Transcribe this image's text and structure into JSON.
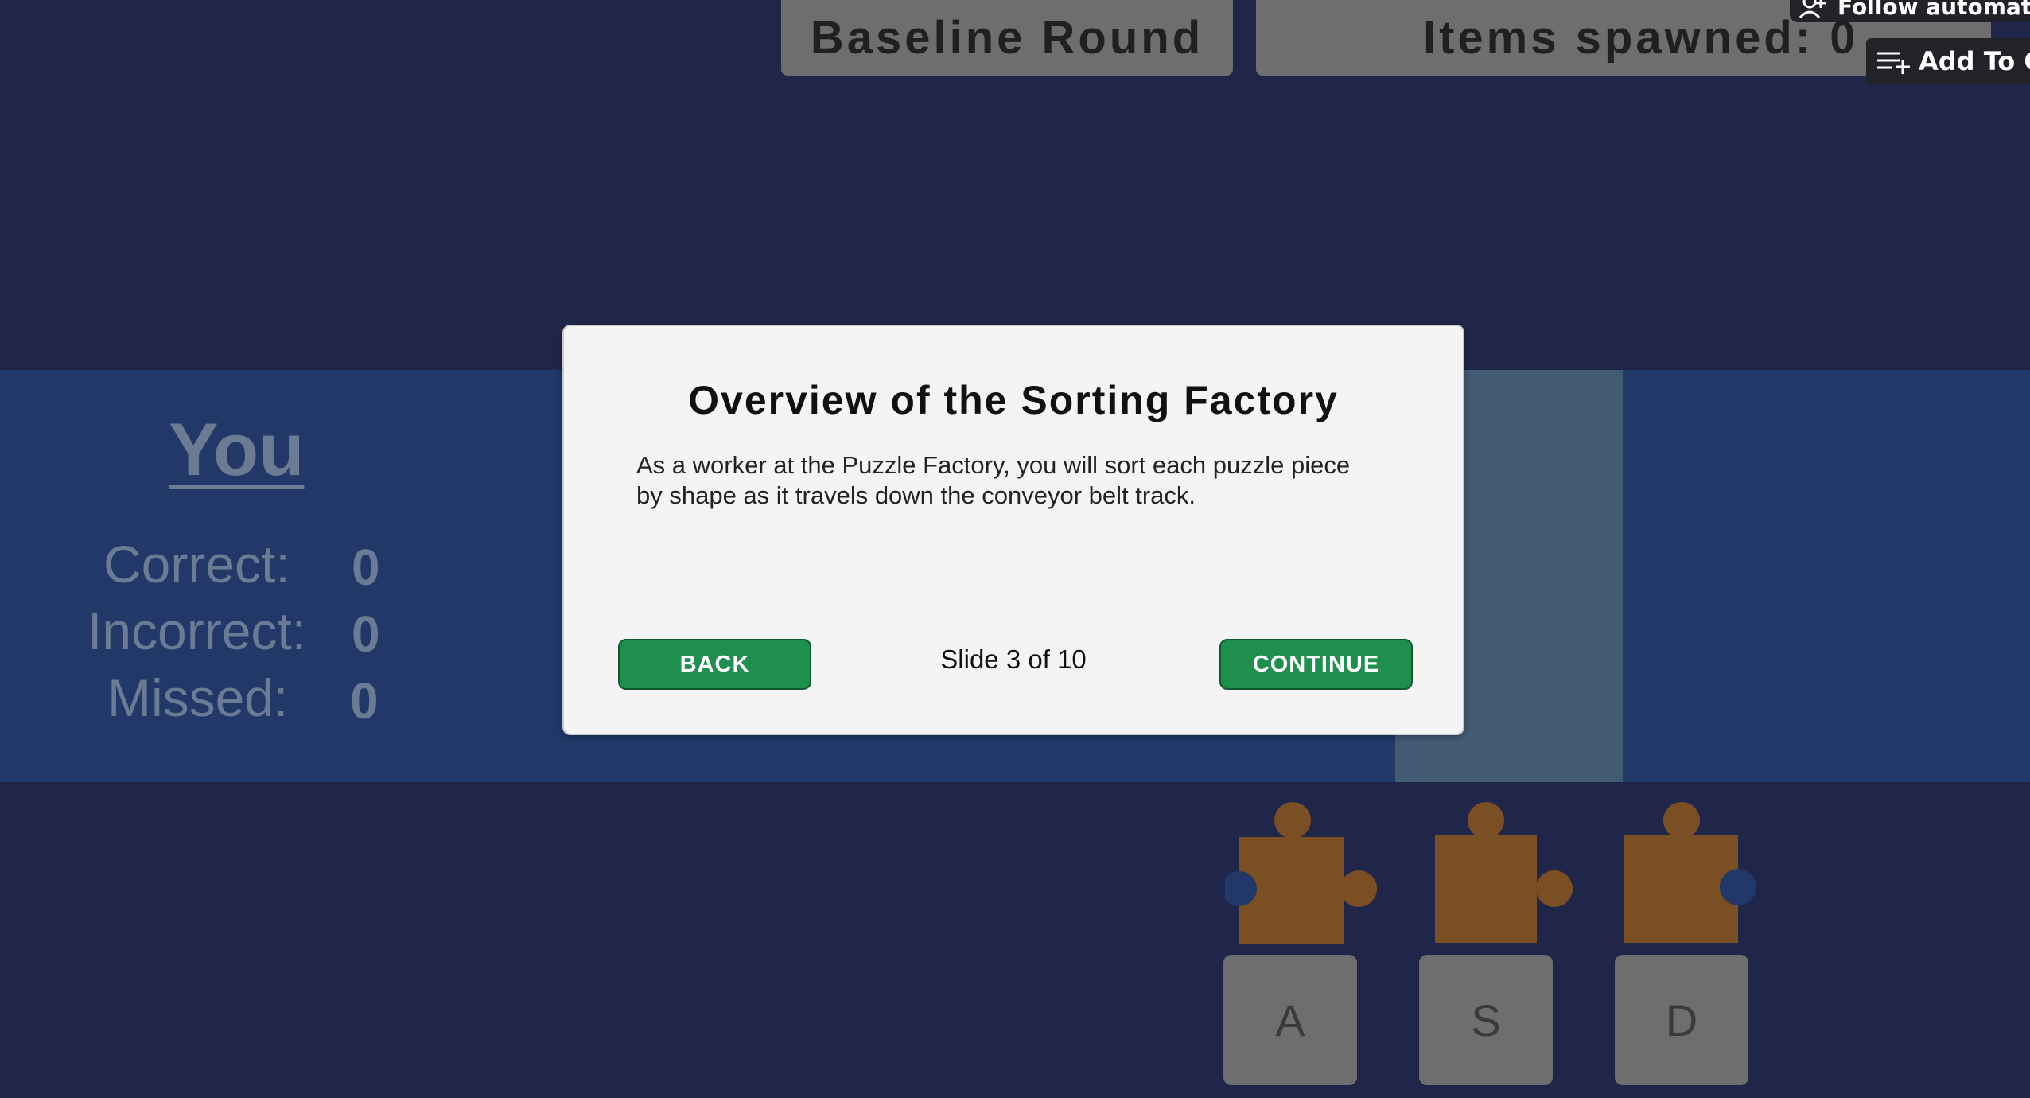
{
  "header": {
    "round_label": "Baseline Round",
    "items_spawned_label": "Items spawned: 0"
  },
  "overlay": {
    "follow_label": "Follow automatic",
    "add_label": "Add To Co"
  },
  "stats": {
    "title": "You",
    "rows": [
      {
        "label": "Correct:",
        "value": "0"
      },
      {
        "label": "Incorrect:",
        "value": "0"
      },
      {
        "label": "Missed:",
        "value": "0"
      }
    ]
  },
  "modal": {
    "title": "Overview of the Sorting Factory",
    "body": "As a worker at the Puzzle Factory, you will sort each puzzle piece by shape as it travels down the conveyor belt track.",
    "back_label": "BACK",
    "continue_label": "CONTINUE",
    "slide_indicator": "Slide 3 of 10"
  },
  "bins": [
    {
      "key": "A",
      "piece_shape": "tab-top, blank-left, tab-right"
    },
    {
      "key": "S",
      "piece_shape": "tab-top, tab-right"
    },
    {
      "key": "D",
      "piece_shape": "tab-top, blank-right"
    }
  ],
  "colors": {
    "background": "#1f2649",
    "band": "#213868",
    "lane": "#435a73",
    "piece": "#7a4f24",
    "button_green": "#1f8f4e",
    "panel_gray": "#6e6e6e"
  }
}
